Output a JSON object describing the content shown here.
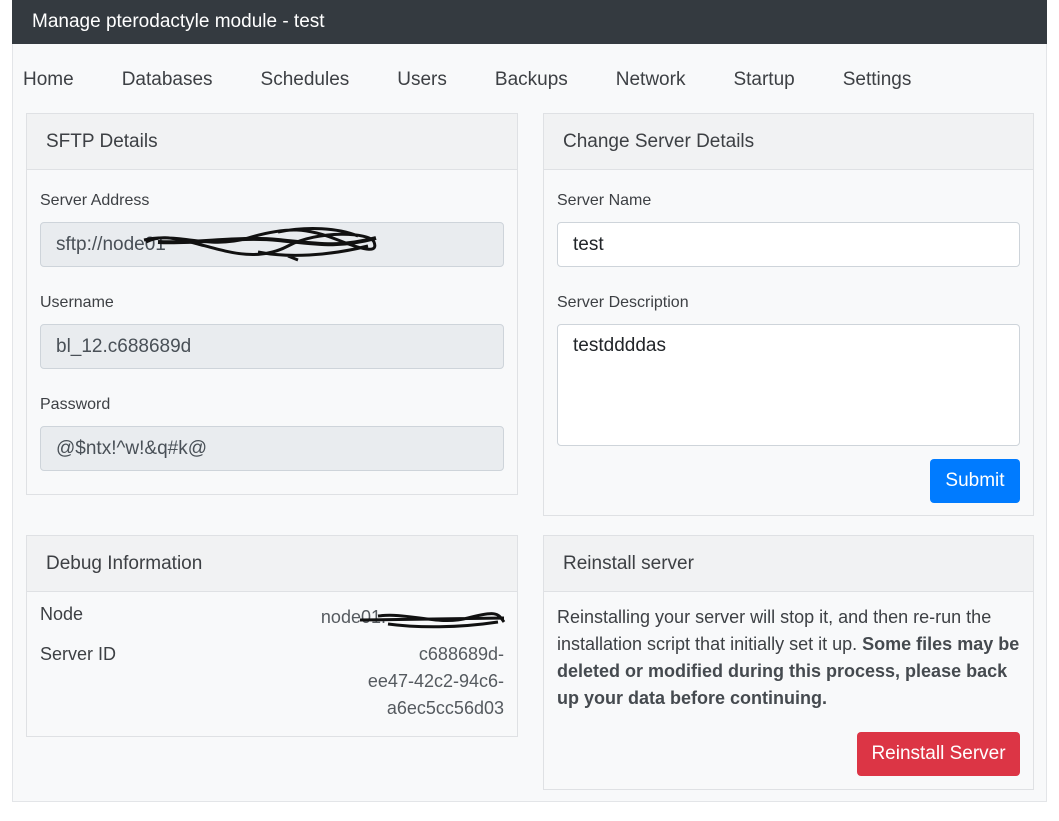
{
  "app": {
    "title": "Manage pterodactyle module - test"
  },
  "nav": {
    "items": [
      "Home",
      "Databases",
      "Schedules",
      "Users",
      "Backups",
      "Network",
      "Startup",
      "Settings"
    ]
  },
  "sftp": {
    "title": "SFTP Details",
    "address_label": "Server Address",
    "address_value": "sftp://node01",
    "username_label": "Username",
    "username_value": "bl_12.c688689d",
    "password_label": "Password",
    "password_value": "@$ntx!^w!&q#k@"
  },
  "server": {
    "title": "Change Server Details",
    "name_label": "Server Name",
    "name_value": "test",
    "desc_label": "Server Description",
    "desc_value": "testddddas",
    "submit_label": "Submit"
  },
  "debug": {
    "title": "Debug Information",
    "node_label": "Node",
    "node_value": "node01.",
    "id_label": "Server ID",
    "id_line1": "c688689d-",
    "id_line2": "ee47-42c2-94c6-",
    "id_line3": "a6ec5cc56d03"
  },
  "reinstall": {
    "title": "Reinstall server",
    "text": "Reinstalling your server will stop it, and then re-run the installation script that initially set it up.",
    "warning": "Some files may be deleted or modified during this process, please back up your data before continuing.",
    "button_label": "Reinstall Server"
  },
  "colors": {
    "primary": "#007bff",
    "danger": "#dc3545",
    "titlebar": "#343a40"
  }
}
